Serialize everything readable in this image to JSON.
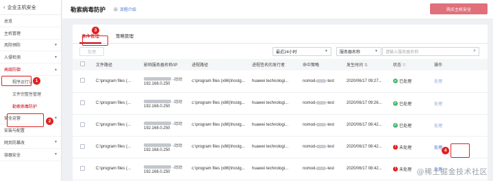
{
  "sidebar": {
    "title": "企业主机安全",
    "items": [
      {
        "label": "总览",
        "caret": false
      },
      {
        "label": "主机管理",
        "caret": false
      },
      {
        "label": "风险预防",
        "caret": true
      },
      {
        "label": "入侵检测",
        "caret": true
      },
      {
        "label": "高级防御",
        "caret": true,
        "active": true
      }
    ],
    "subitems": [
      {
        "label": "程序运行认证"
      },
      {
        "label": "文件完整性管理"
      },
      {
        "label": "勒索病毒防护",
        "active": true
      }
    ],
    "items_after": [
      {
        "label": "安全运营",
        "caret": true
      },
      {
        "label": "安装与配置",
        "caret": false
      },
      {
        "label": "网页防篡改",
        "caret": true
      },
      {
        "label": "容器安全",
        "caret": true
      }
    ]
  },
  "header": {
    "title": "勒索病毒防护",
    "flow_link": "流程介绍",
    "buy_button": "购买主机安全"
  },
  "tabs": [
    {
      "label": "事件管理",
      "active": true
    },
    {
      "label": "策略管理",
      "active": false
    }
  ],
  "toolbar": {
    "handle_button": "处理",
    "time_filter": "最近24小时",
    "search_field": "服务器名称",
    "search_placeholder": "请输入服务器名称"
  },
  "table": {
    "columns": [
      "文件路径",
      "影响服务器名称/IP",
      "进程路径",
      "进程签名的发行者",
      "命中策略",
      "发生时间",
      "状态",
      "操作"
    ],
    "rows": [
      {
        "file_path": "C:\\program files (...",
        "server_suffix": "-动动",
        "ip": "192.168.0.250",
        "process_path": "c:\\program files (x86)\\hostg...",
        "issuer": "huawei technologi...",
        "policy": "nomod-",
        "policy_suffix": "-test",
        "time": "2020/06/17 09:27...",
        "status": "已处理",
        "status_ok": true,
        "action": "处理"
      },
      {
        "file_path": "C:\\program files (...",
        "server_suffix": "-动动",
        "ip": "192.168.0.250",
        "process_path": "c:\\program files (x86)\\hostg...",
        "issuer": "huawei technologi...",
        "policy": "nomod-",
        "policy_suffix": "-test",
        "time": "2020/06/17 09:26...",
        "status": "已处理",
        "status_ok": true,
        "action": "处理"
      },
      {
        "file_path": "C:\\program files (...",
        "server_suffix": "-动动",
        "ip": "192.168.0.250",
        "process_path": "c:\\program files (x86)\\hostg...",
        "issuer": "huawei technologi...",
        "policy": "nomod-",
        "policy_suffix": "-test",
        "time": "2020/06/17 08:42...",
        "status": "已处理",
        "status_ok": true,
        "action": "处理"
      },
      {
        "file_path": "C:\\program files (...",
        "server_suffix": "-动动",
        "ip": "192.168.0.250",
        "process_path": "c:\\program files (x86)\\hostg...",
        "issuer": "huawei technologi...",
        "policy": "nomod-",
        "policy_suffix": "-test",
        "time": "2020/06/17 08:42...",
        "status": "未处理",
        "status_ok": false,
        "action": "处理"
      },
      {
        "file_path": "C:\\program files (...",
        "server_suffix": "-动动",
        "ip": "192.168.0.250",
        "process_path": "c:\\program files (x86)\\hostg...",
        "issuer": "huawei technologi...",
        "policy": "nomod-",
        "policy_suffix": "-test",
        "time": "2020/06/17 08:42...",
        "status": "未处理",
        "status_ok": false,
        "action": "处理"
      }
    ]
  },
  "annotations": [
    "1",
    "2",
    "3",
    "4"
  ],
  "watermark": "@稀土掘金技术社区",
  "colors": {
    "accent": "#c7000b",
    "annotation": "#e02020",
    "link": "#3f6fd6",
    "ok": "#4dba6f"
  }
}
